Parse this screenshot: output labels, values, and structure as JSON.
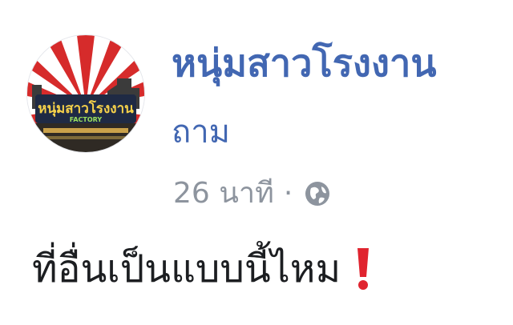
{
  "post": {
    "page_name": "หนุ่มสาวโรงงาน",
    "subtitle": "ถาม",
    "time": "26 นาที",
    "separator": "·",
    "privacy_icon": "globe-icon",
    "text": "ที่อื่นเป็นแบบนี้ไหม",
    "emoji_icon": "red-exclamation-icon"
  },
  "avatar": {
    "logo_text": "หนุ่มสาวโรงงาน",
    "logo_subtext": "FACTORY",
    "colors": {
      "ray": "#d62b2b",
      "ground": "#2f2a24",
      "logo_bg": "#1f2a44"
    }
  },
  "colors": {
    "name": "#4267b2",
    "meta": "#8d949e",
    "text": "#1c1e21",
    "exclaim": "#e0242f"
  }
}
